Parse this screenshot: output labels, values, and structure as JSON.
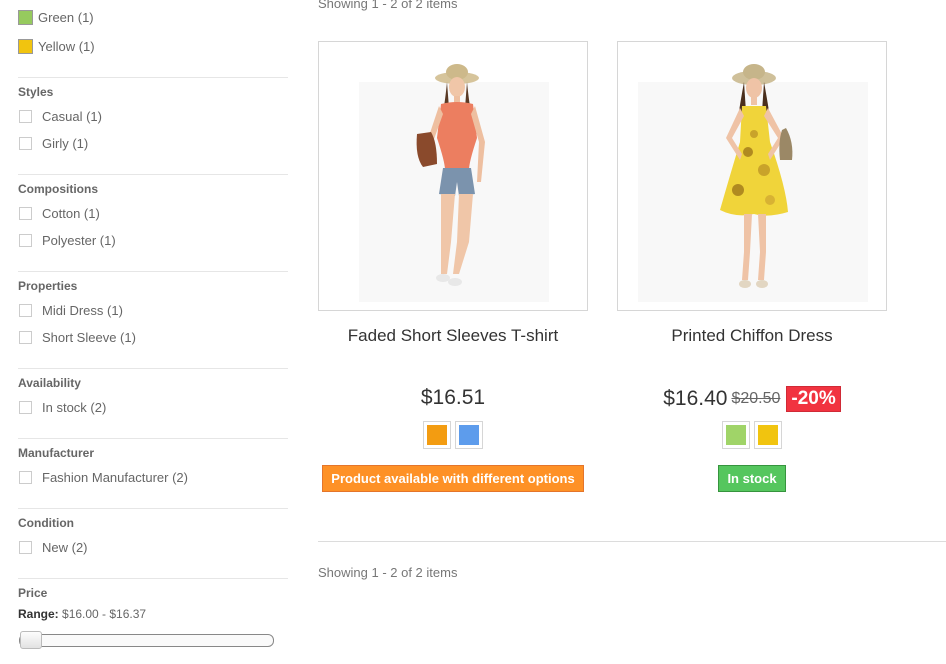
{
  "filters": {
    "colors": [
      {
        "label": "Green (1)",
        "color": "#96ca5e"
      },
      {
        "label": "Yellow (1)",
        "color": "#f1c40f"
      }
    ],
    "styles": {
      "title": "Styles",
      "items": [
        "Casual (1)",
        "Girly (1)"
      ]
    },
    "compositions": {
      "title": "Compositions",
      "items": [
        "Cotton (1)",
        "Polyester (1)"
      ]
    },
    "properties": {
      "title": "Properties",
      "items": [
        "Midi Dress (1)",
        "Short Sleeve (1)"
      ]
    },
    "availability": {
      "title": "Availability",
      "items": [
        "In stock (2)"
      ]
    },
    "manufacturer": {
      "title": "Manufacturer",
      "items": [
        "Fashion Manufacturer (2)"
      ]
    },
    "condition": {
      "title": "Condition",
      "items": [
        "New (2)"
      ]
    },
    "price": {
      "title": "Price",
      "range_key": "Range:",
      "range_value": "$16.00 - $16.37",
      "slider_position": 0
    }
  },
  "main": {
    "showing_top": "Showing 1 - 2 of 2 items",
    "showing_bottom": "Showing 1 - 2 of 2 items",
    "products": [
      {
        "name": "Faded Short Sleeves T-shirt",
        "price": "$16.51",
        "old_price": "",
        "discount": "",
        "swatches": [
          "#f39c11",
          "#5d9cec"
        ],
        "availability": "Product available with different options",
        "availability_color": "#fe9126"
      },
      {
        "name": "Printed Chiffon Dress",
        "price": "$16.40",
        "old_price": "$20.50",
        "discount": "-20%",
        "swatches": [
          "#a0d468",
          "#f1c40f"
        ],
        "availability": "In stock",
        "availability_color": "#55c65e"
      }
    ]
  }
}
